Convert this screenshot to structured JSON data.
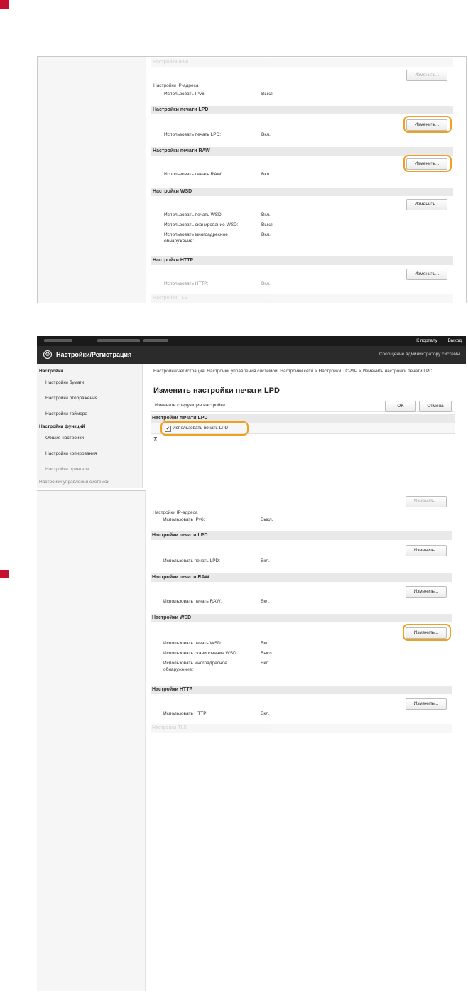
{
  "shot1": {
    "header_ipv6": "Настройки IPv6",
    "ipv6_button": "Изменить...",
    "ip_subhead": "Настройки IP-адреса",
    "use_ipv6_label": "Использовать IPv6",
    "use_ipv6_value": "Выкл.",
    "lpd_header": "Настройки печати LPD",
    "lpd_button": "Изменить...",
    "use_lpd_label": "Использовать печать LPD:",
    "use_lpd_value": "Вкл.",
    "raw_header": "Настройки печати RAW",
    "raw_button": "Изменить...",
    "use_raw_label": "Использовать печать RAW:",
    "use_raw_value": "Вкл.",
    "wsd_header": "Настройки WSD",
    "wsd_button": "Изменить...",
    "wsd_print_label": "Использовать печать WSD:",
    "wsd_print_value": "Вкл.",
    "wsd_scan_label": "Использовать сканирование WSD:",
    "wsd_scan_value": "Выкл.",
    "wsd_multicast_label": "Использовать многоадресное обнаружение:",
    "wsd_multicast_value": "Вкл.",
    "http_header": "Настройки HTTP",
    "http_button": "Изменить...",
    "use_http_label": "Использовать HTTP:",
    "use_http_value": "Вкл.",
    "tls_header": "Настройки TLS"
  },
  "shot2": {
    "top_links": [
      "К порталу",
      "Выход"
    ],
    "title": "Настройки/Регистрация",
    "admin_message": "Сообщение администратору системы",
    "sidebar": {
      "group1": "Настройки",
      "paper": "Настройки бумаги",
      "display": "Настройки отображения",
      "timer": "Настройки таймера",
      "group2": "Настройки функций",
      "common": "Общие настройки",
      "copy": "Настройки копирования",
      "printer": "Настройки принтера",
      "sysmgmt": "Настройки управления системой"
    },
    "breadcrumb": "Настройки/Регистрация: Настройки управления системой: Настройки сети > Настройки TCP/IP > Изменить настройки печати LPD",
    "page_title": "Изменить настройки печати LPD",
    "instruction": "Измените следующие настройки.",
    "ok": "OK",
    "cancel": "Отмена",
    "section": "Настройки печати LPD",
    "checkbox_label": "Использовать печать LPD",
    "checkbox_checked": true,
    "top_glyph": "⊼"
  },
  "shot3": {
    "top_button": "Изменить...",
    "ip_subhead": "Настройки IP-адреса",
    "use_ipv6_label": "Использовать IPv6:",
    "use_ipv6_value": "Выкл.",
    "lpd_header": "Настройки печати LPD",
    "lpd_button": "Изменить...",
    "use_lpd_label": "Использовать печать LPD:",
    "use_lpd_value": "Вкл.",
    "raw_header": "Настройки печати RAW",
    "raw_button": "Изменить...",
    "use_raw_label": "Использовать печать RAW:",
    "use_raw_value": "Вкл.",
    "wsd_header": "Настройки WSD",
    "wsd_button": "Изменить...",
    "wsd_print_label": "Использовать печать WSD:",
    "wsd_print_value": "Вкл.",
    "wsd_scan_label": "Использовать сканирование WSD:",
    "wsd_scan_value": "Выкл.",
    "wsd_multicast_label": "Использовать многоадресное обнаружение:",
    "wsd_multicast_value": "Вкл.",
    "http_header": "Настройки HTTP",
    "http_button": "Изменить...",
    "use_http_label": "Использовать HTTP:",
    "use_http_value": "Вкл.",
    "tls_header": "Настройки TLS"
  },
  "colors": {
    "step_marker": "#c8102e",
    "highlight": "#f0a020",
    "header_dark": "#1a1a1a"
  }
}
